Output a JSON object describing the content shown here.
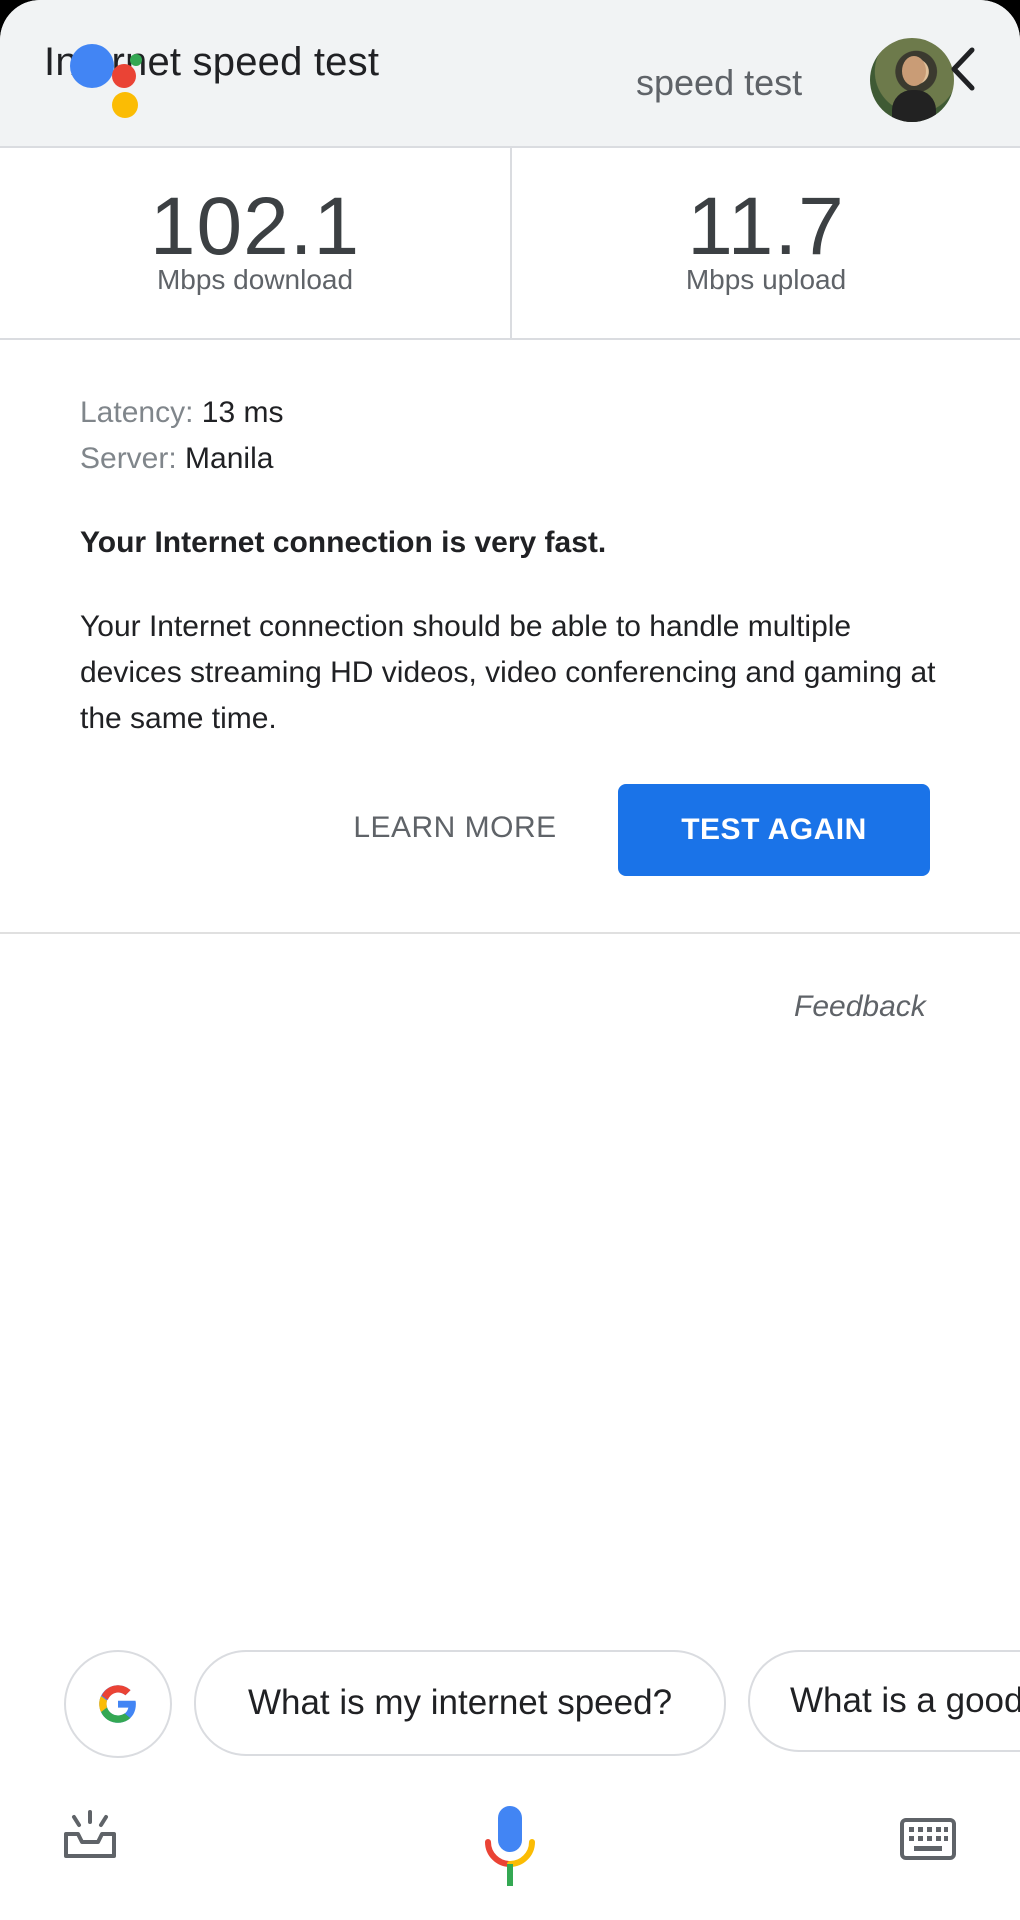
{
  "header": {
    "title": "Internet speed test",
    "query": "speed test"
  },
  "results": {
    "download": {
      "value": "102.1",
      "unit": "Mbps download"
    },
    "upload": {
      "value": "11.7",
      "unit": "Mbps upload"
    }
  },
  "details": {
    "latency_label": "Latency:",
    "latency_value": "13 ms",
    "server_label": "Server:",
    "server_value": "Manila",
    "verdict": "Your Internet connection is very fast.",
    "description": "Your Internet connection should be able to handle multiple devices streaming HD videos, video conferencing and gaming at the same time."
  },
  "actions": {
    "learn_more": "LEARN MORE",
    "test_again": "TEST AGAIN",
    "feedback": "Feedback"
  },
  "suggestions": [
    "What is my internet speed?",
    "What is a good"
  ],
  "colors": {
    "accent": "#1a73e8",
    "header_bg": "#f1f3f4",
    "assistant_blue": "#4285f4",
    "assistant_red": "#ea4335",
    "assistant_yellow": "#fbbc04",
    "assistant_green": "#34a853"
  },
  "icons": {
    "assistant": "google-assistant-dots-icon",
    "avatar": "user-avatar",
    "back": "chevron-left-icon",
    "google": "google-g-icon",
    "explore": "explore-tray-icon",
    "mic": "mic-icon",
    "keyboard": "keyboard-icon"
  }
}
